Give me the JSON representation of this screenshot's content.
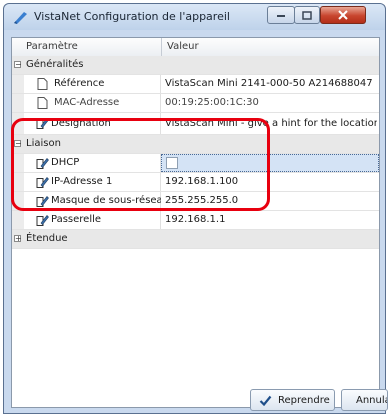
{
  "window": {
    "title": "VistaNet Configuration de l'appareil"
  },
  "grid": {
    "col_property": "Paramètre",
    "col_value": "Valeur"
  },
  "categories": {
    "general": "Généralités",
    "link": "Liaison",
    "extended": "Étendue"
  },
  "rows": {
    "reference": {
      "name": "Référence",
      "value": "VistaScan Mini 2141-000-50 A214688047"
    },
    "mac": {
      "name": "MAC-Adresse",
      "value": "00:19:25:00:1C:30"
    },
    "designation": {
      "name": "Désignation",
      "value": "VistaScan Mini - give a hint for the location"
    },
    "dhcp": {
      "name": "DHCP",
      "value": ""
    },
    "ip": {
      "name": "IP-Adresse 1",
      "value": "192.168.1.100"
    },
    "mask": {
      "name": "Masque de sous-réseau",
      "value": "255.255.255.0"
    },
    "gateway": {
      "name": "Passerelle",
      "value": "192.168.1.1"
    }
  },
  "buttons": {
    "apply": "Reprendre",
    "cancel": "Annulation"
  },
  "colors": {
    "highlight": "#e8000f",
    "titlebar": "#c9d9ee",
    "close_button": "#c8452e"
  }
}
